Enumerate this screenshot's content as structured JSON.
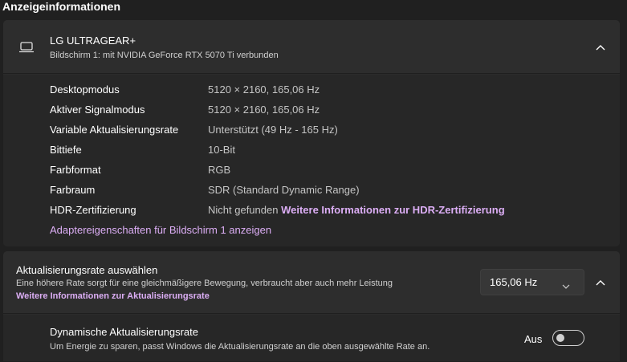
{
  "section_title": "Anzeigeinformationen",
  "display": {
    "name": "LG ULTRAGEAR+",
    "subtitle": "Bildschirm 1: mit NVIDIA GeForce RTX 5070 Ti verbunden",
    "icon": "monitor-icon",
    "expanded": true,
    "rows": [
      {
        "label": "Desktopmodus",
        "value": "5120 × 2160, 165,06 Hz"
      },
      {
        "label": "Aktiver Signalmodus",
        "value": "5120 × 2160, 165,06 Hz"
      },
      {
        "label": "Variable Aktualisierungsrate",
        "value": "Unterstützt (49 Hz - 165 Hz)"
      },
      {
        "label": "Bittiefe",
        "value": "10-Bit"
      },
      {
        "label": "Farbformat",
        "value": "RGB"
      },
      {
        "label": "Farbraum",
        "value": "SDR (Standard Dynamic Range)"
      },
      {
        "label": "HDR-Zertifizierung",
        "value": "Nicht gefunden",
        "link": "Weitere Informationen zur HDR-Zertifizierung"
      }
    ],
    "adapter_link": "Adaptereigenschaften für Bildschirm 1 anzeigen"
  },
  "refresh_rate": {
    "title": "Aktualisierungsrate auswählen",
    "description": "Eine höhere Rate sorgt für eine gleichmäßigere Bewegung, verbraucht aber auch mehr Leistung",
    "link": "Weitere Informationen zur Aktualisierungsrate",
    "selected": "165,06 Hz",
    "expanded": true,
    "dynamic": {
      "title": "Dynamische Aktualisierungsrate",
      "description": "Um Energie zu sparen, passt Windows die Aktualisierungsrate an die oben ausgewählte Rate an.",
      "toggle_label": "Aus",
      "enabled": false
    }
  },
  "colors": {
    "background": "#202020",
    "card": "#2b2b2b",
    "link": "#dcaef5"
  }
}
